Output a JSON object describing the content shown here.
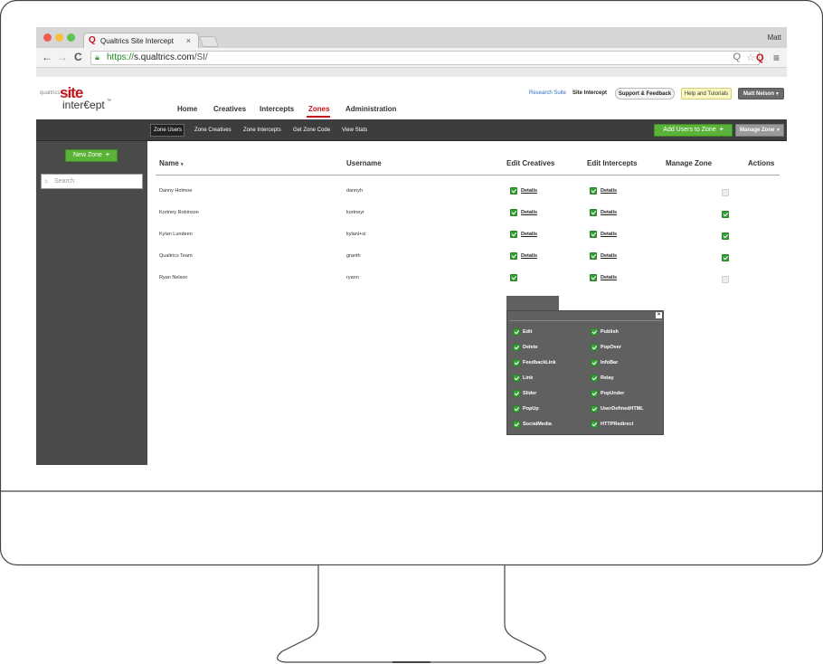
{
  "browser": {
    "tab_title": "Qualtrics Site Intercept",
    "tab_close": "×",
    "user": "Matt",
    "url_https": "https://",
    "url_host": "s.qualtrics.com",
    "url_path": "/SI/",
    "nav_back": "←",
    "nav_forward": "→",
    "nav_reload": "C",
    "zoom_icon": "Q",
    "star_icon": "☆",
    "menu_icon": "≡",
    "ext_icon": "Q"
  },
  "logo": {
    "qualtrics": "qualtrics",
    "site": "site",
    "intercept": "inter€ept",
    "tm": "™"
  },
  "header": {
    "links": {
      "research_suite": "Research Suite",
      "site_intercept": "Site Intercept"
    },
    "support_btn": "Support & Feedback",
    "help_btn": "Help and Tutorials",
    "user_btn": "Matt Nelson",
    "nav": [
      "Home",
      "Creatives",
      "Intercepts",
      "Zones",
      "Administration"
    ]
  },
  "subnav": {
    "tabs": [
      "Zone Users",
      "Zone Creatives",
      "Zone Intercepts",
      "Get Zone Code",
      "View Stats"
    ],
    "add_users": "Add Users to Zone",
    "manage_zone": "Manage Zone"
  },
  "sidebar": {
    "new_zone": "New Zone",
    "search_placeholder": "Search"
  },
  "table": {
    "headers": [
      "Name",
      "Username",
      "Edit Creatives",
      "Edit Intercepts",
      "Manage Zone",
      "Actions"
    ],
    "details_label": "Details",
    "rows": [
      {
        "name": "Danny Holmoe",
        "username": "dannyh",
        "manage": false
      },
      {
        "name": "Kortney Robinson",
        "username": "kortneyr",
        "manage": true
      },
      {
        "name": "Kylan Lundeen",
        "username": "kylanl+si",
        "manage": true
      },
      {
        "name": "Qualtrics Team",
        "username": "granth",
        "manage": true
      },
      {
        "name": "Ryan Nelson",
        "username": "ryann",
        "manage": false
      }
    ]
  },
  "popup": {
    "close": "×",
    "left": [
      "Edit",
      "Delete",
      "FeedbackLink",
      "Link",
      "Slider",
      "PopUp",
      "SocialMedia"
    ],
    "right": [
      "Publish",
      "PopOver",
      "InfoBar",
      "Relay",
      "PopUnder",
      "UserDefinedHTML",
      "HTTPRedirect"
    ]
  },
  "colors": {
    "brand_red": "#c0151b",
    "green": "#5ab238",
    "dark_bar": "#3d3d3d",
    "sidebar": "#4a4a4a"
  }
}
